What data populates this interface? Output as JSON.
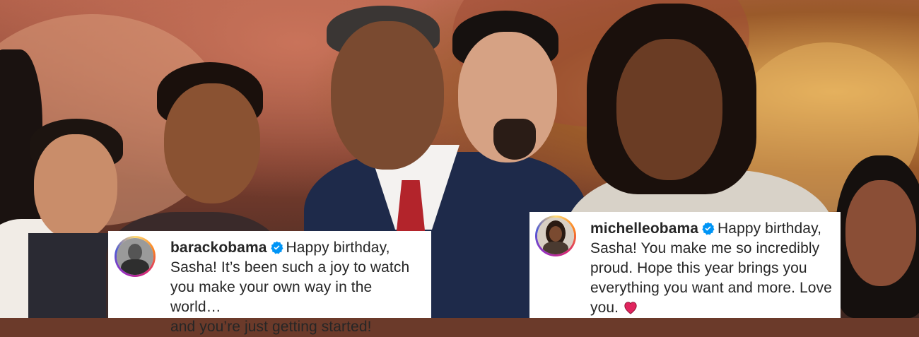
{
  "captions": [
    {
      "username": "barackobama",
      "lines": [
        "Happy birthday,",
        "Sasha! It’s been such a joy to watch",
        "you make your own way in the world…",
        "and you’re just getting started!"
      ],
      "avatar": "barackobama-avatar"
    },
    {
      "username": "michelleobama",
      "lines": [
        "Happy birthday,",
        "Sasha! You make me so incredibly",
        "proud. Hope this year brings you",
        "everything you want and more. Love",
        "you."
      ],
      "avatar": "michelleobama-avatar"
    }
  ],
  "icons": {
    "verified": "verified-badge-icon",
    "heart": "red-heart-emoji-icon"
  },
  "colors": {
    "verified": "#0095f6",
    "heart": "#e0245e",
    "text": "#262626",
    "caption_bg": "#ffffff"
  }
}
